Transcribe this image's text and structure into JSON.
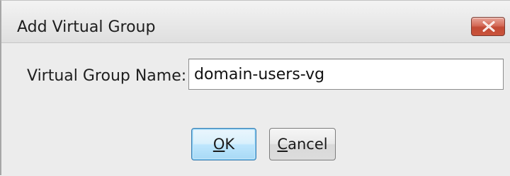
{
  "window": {
    "title": "Add Virtual Group",
    "close_icon": "close-icon"
  },
  "form": {
    "name_label": "Virtual Group Name:",
    "name_value": "domain-users-vg"
  },
  "buttons": {
    "ok": {
      "mnemonic": "O",
      "rest": "K"
    },
    "cancel": {
      "mnemonic": "C",
      "rest": "ancel"
    }
  },
  "colors": {
    "close_button": "#c9533b",
    "default_button_border": "#3c7fb1",
    "dialog_background": "#ececec"
  }
}
